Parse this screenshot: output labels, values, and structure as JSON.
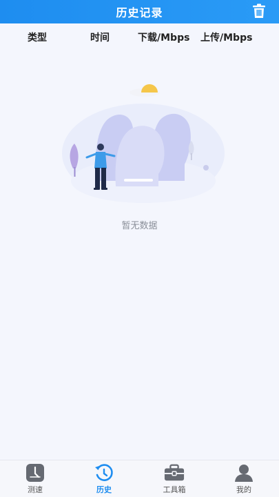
{
  "header": {
    "title": "历史记录",
    "trash_icon": "trash-icon"
  },
  "columns": {
    "type": "类型",
    "time": "时间",
    "download": "下载/Mbps",
    "upload": "上传/Mbps"
  },
  "empty": {
    "message": "暂无数据"
  },
  "tabs": [
    {
      "label": "测速",
      "icon": "speedometer-icon",
      "active": false
    },
    {
      "label": "历史",
      "icon": "history-icon",
      "active": true
    },
    {
      "label": "工具箱",
      "icon": "toolbox-icon",
      "active": false
    },
    {
      "label": "我的",
      "icon": "person-icon",
      "active": false
    }
  ],
  "colors": {
    "accent": "#1e8df0",
    "background": "#f4f6fd",
    "inactive": "#555555"
  }
}
